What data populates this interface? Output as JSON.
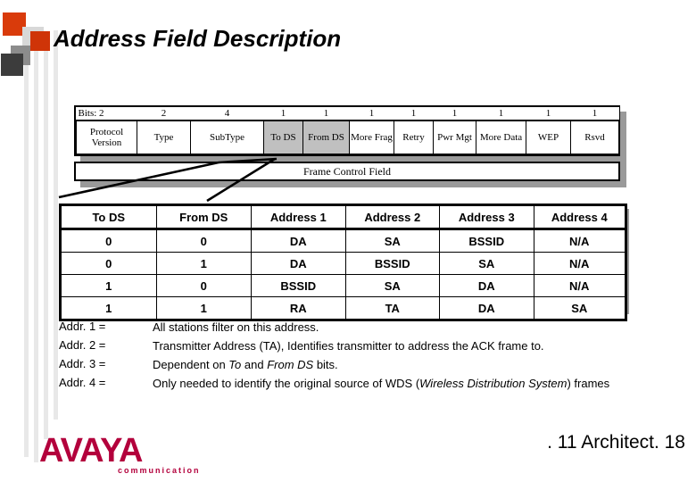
{
  "slide": {
    "title": "Address Field Description",
    "footer": ". 11 Architect.  18"
  },
  "logo": {
    "wordmark": "AVAYA",
    "tagline": "communication"
  },
  "frame_control": {
    "caption": "Frame Control Field",
    "bits_label": "Bits:",
    "bits": [
      "2",
      "2",
      "4",
      "1",
      "1",
      "1",
      "1",
      "1",
      "1",
      "1",
      "1"
    ],
    "fields": [
      {
        "label": "Protocol Version",
        "shaded": false
      },
      {
        "label": "Type",
        "shaded": false
      },
      {
        "label": "SubType",
        "shaded": false
      },
      {
        "label": "To DS",
        "shaded": true
      },
      {
        "label": "From DS",
        "shaded": true
      },
      {
        "label": "More Frag",
        "shaded": false
      },
      {
        "label": "Retry",
        "shaded": false
      },
      {
        "label": "Pwr Mgt",
        "shaded": false
      },
      {
        "label": "More Data",
        "shaded": false
      },
      {
        "label": "WEP",
        "shaded": false
      },
      {
        "label": "Rsvd",
        "shaded": false
      }
    ]
  },
  "address_table": {
    "headers": [
      "To DS",
      "From DS",
      "Address 1",
      "Address 2",
      "Address 3",
      "Address 4"
    ],
    "rows": [
      [
        "0",
        "0",
        "DA",
        "SA",
        "BSSID",
        "N/A"
      ],
      [
        "0",
        "1",
        "DA",
        "BSSID",
        "SA",
        "N/A"
      ],
      [
        "1",
        "0",
        "BSSID",
        "SA",
        "DA",
        "N/A"
      ],
      [
        "1",
        "1",
        "RA",
        "TA",
        "DA",
        "SA"
      ]
    ]
  },
  "notes": [
    {
      "key": "Addr. 1 =",
      "text": "All stations filter on this address."
    },
    {
      "key": "Addr. 2 =",
      "text": "Transmitter Address (TA), Identifies transmitter to address the ACK frame to."
    },
    {
      "key": "Addr. 3 =",
      "text_pre": "Dependent on ",
      "em1": "To",
      "text_mid": " and ",
      "em2": "From DS",
      "text_post": " bits."
    },
    {
      "key": "Addr. 4 =",
      "text_pre": "Only needed to identify the original source of  WDS (",
      "em1": "Wireless Distribution System",
      "text_post": ") frames"
    }
  ],
  "colors": {
    "accent_red": "#cc3300",
    "logo_red": "#b3003c",
    "shaded_cell": "#c0c0c0",
    "shadow": "#9a9a9a",
    "rule_gray": "#e8e8e8"
  }
}
